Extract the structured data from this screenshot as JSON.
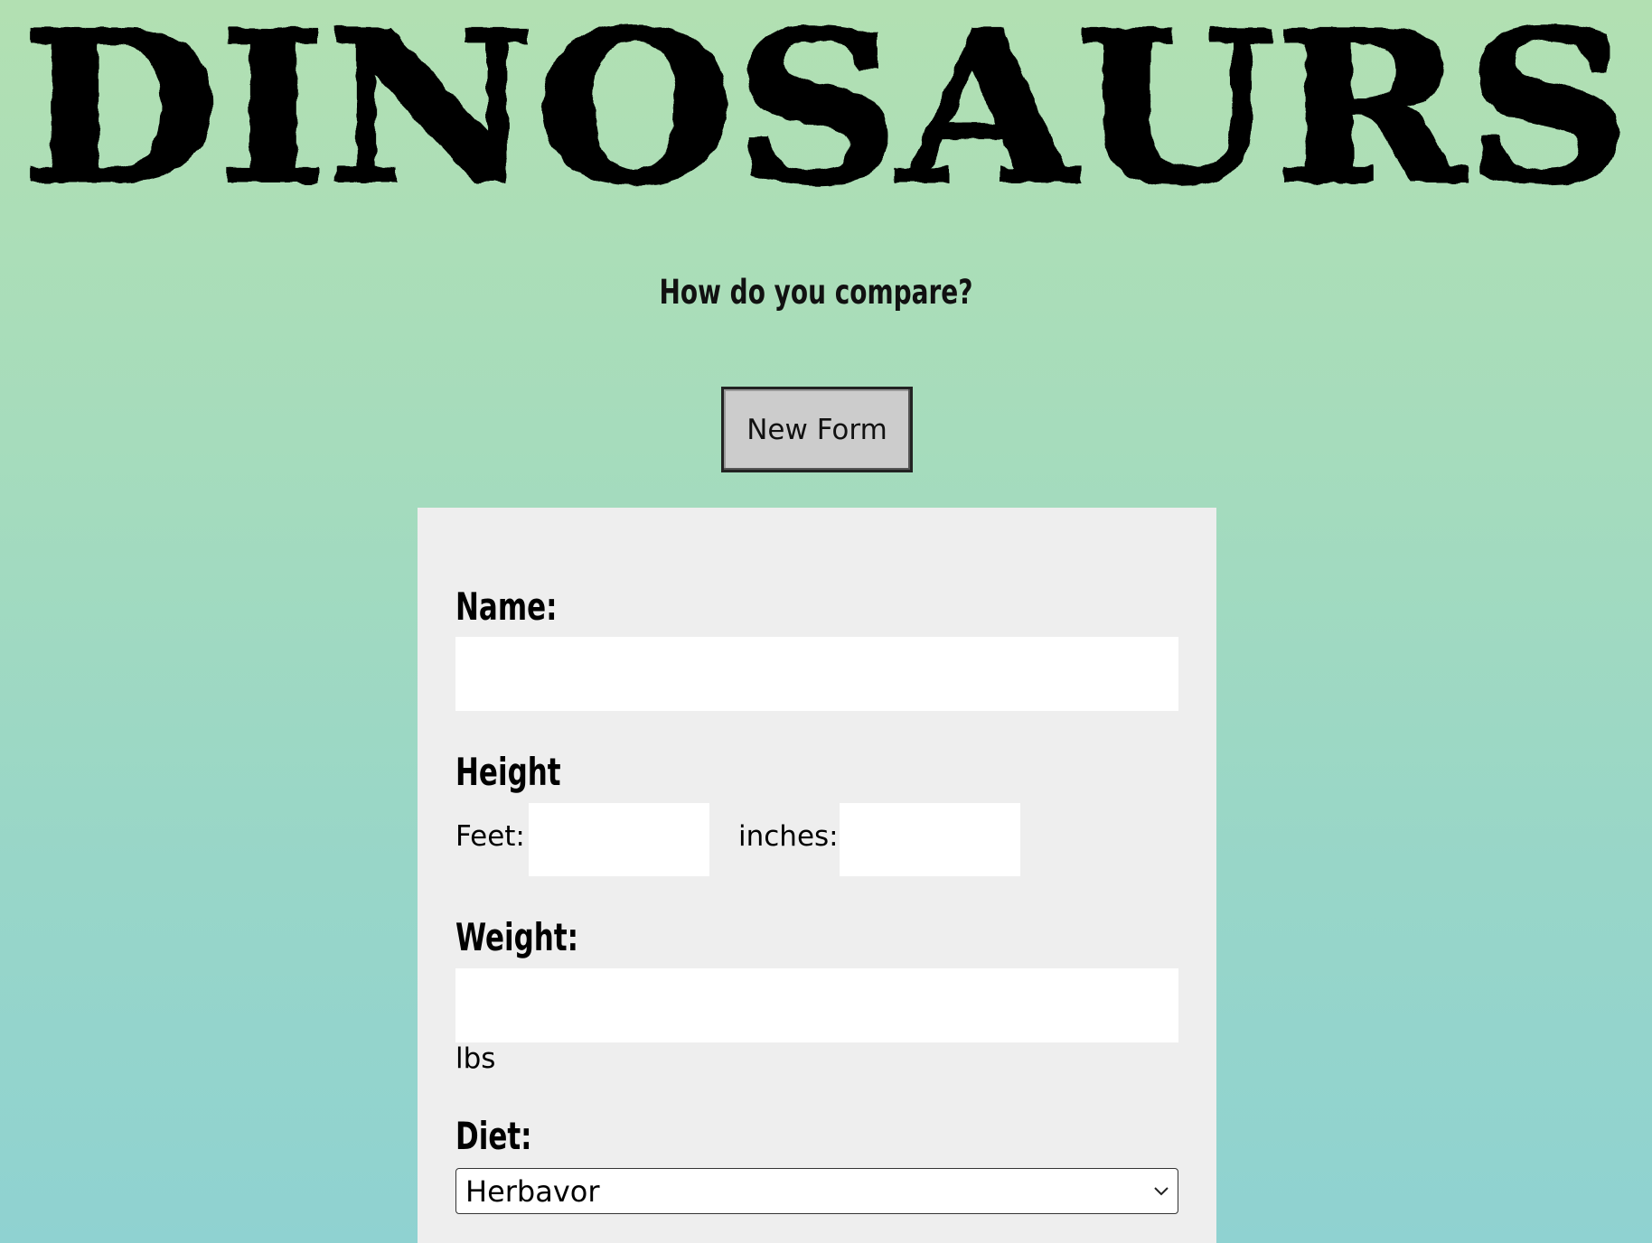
{
  "header": {
    "title": "DINOSAURS",
    "subtitle": "How do you compare?"
  },
  "actions": {
    "new_form_label": "New Form"
  },
  "form": {
    "name": {
      "label": "Name:",
      "value": ""
    },
    "height": {
      "label": "Height",
      "feet_label": "Feet:",
      "feet_value": "",
      "inches_label": "inches:",
      "inches_value": ""
    },
    "weight": {
      "label": "Weight:",
      "value": "",
      "unit": "lbs"
    },
    "diet": {
      "label": "Diet:",
      "selected": "Herbavor"
    }
  }
}
